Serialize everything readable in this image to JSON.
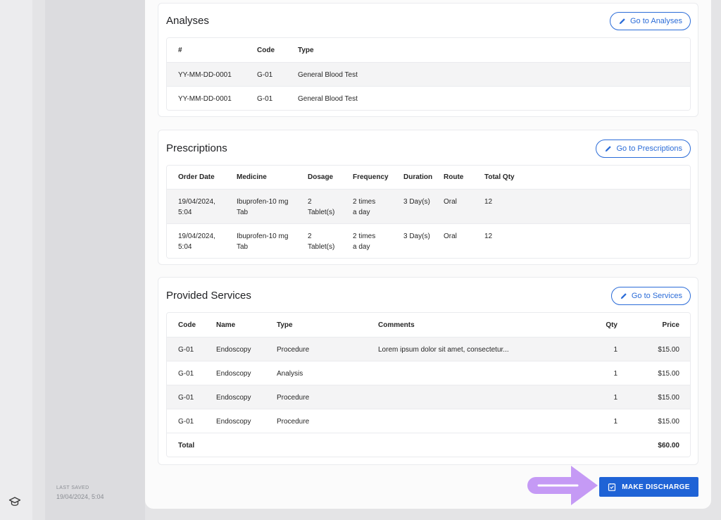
{
  "sidebar": {
    "last_saved_label": "LAST SAVED",
    "last_saved_value": "19/04/2024, 5:04",
    "rail_icon": "graduation-cap-icon"
  },
  "analyses": {
    "title": "Analyses",
    "button_label": "Go to Analyses",
    "columns": [
      "#",
      "Code",
      "Type"
    ],
    "rows": [
      [
        "YY-MM-DD-0001",
        "G-01",
        "General Blood Test"
      ],
      [
        "YY-MM-DD-0001",
        "G-01",
        "General Blood Test"
      ]
    ]
  },
  "prescriptions": {
    "title": "Prescriptions",
    "button_label": "Go to Prescriptions",
    "columns": [
      "Order Date",
      "Medicine",
      "Dosage",
      "Frequency",
      "Duration",
      "Route",
      "Total Qty"
    ],
    "rows": [
      [
        [
          "19/04/2024,",
          "5:04"
        ],
        [
          "Ibuprofen-10 mg",
          "Tab"
        ],
        [
          "2",
          "Tablet(s)"
        ],
        [
          "2 times",
          "a day"
        ],
        [
          "3 Day(s)"
        ],
        [
          "Oral"
        ],
        [
          "12"
        ]
      ],
      [
        [
          "19/04/2024,",
          "5:04"
        ],
        [
          "Ibuprofen-10 mg",
          "Tab"
        ],
        [
          "2",
          "Tablet(s)"
        ],
        [
          "2 times",
          "a day"
        ],
        [
          "3 Day(s)"
        ],
        [
          "Oral"
        ],
        [
          "12"
        ]
      ]
    ]
  },
  "services": {
    "title": "Provided Services",
    "button_label": "Go to Services",
    "columns": [
      "Code",
      "Name",
      "Type",
      "Comments",
      "Qty",
      "Price"
    ],
    "rows": [
      [
        "G-01",
        "Endoscopy",
        "Procedure",
        "Lorem ipsum dolor sit amet, consectetur...",
        "1",
        "$15.00"
      ],
      [
        "G-01",
        "Endoscopy",
        "Analysis",
        "",
        "1",
        "$15.00"
      ],
      [
        "G-01",
        "Endoscopy",
        "Procedure",
        "",
        "1",
        "$15.00"
      ],
      [
        "G-01",
        "Endoscopy",
        "Procedure",
        "",
        "1",
        "$15.00"
      ]
    ],
    "total_label": "Total",
    "total_value": "$60.00"
  },
  "actions": {
    "discharge_label": "MAKE DISCHARGE"
  },
  "colors": {
    "accent": "#1f63d6",
    "annotation_arrow": "#c59af5"
  }
}
